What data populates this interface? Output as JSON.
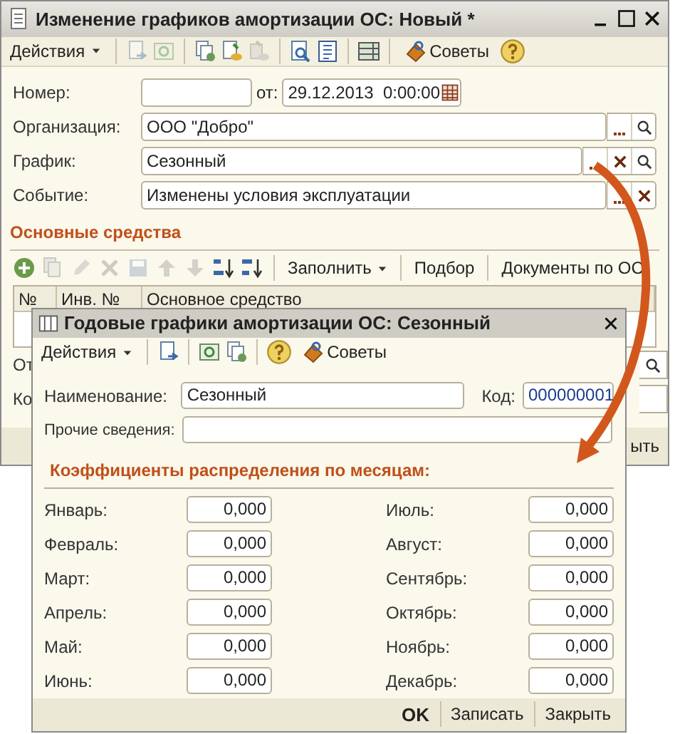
{
  "outer_window": {
    "title": "Изменение графиков амортизации ОС: Новый *",
    "toolbar": {
      "menu": "Действия",
      "icon_buttons": [
        {
          "disabled": true
        },
        {
          "disabled": true
        },
        {
          "disabled": false
        },
        {
          "disabled": false
        },
        {
          "disabled": true
        },
        {
          "disabled": false
        },
        {
          "disabled": false
        },
        {
          "disabled": false
        }
      ],
      "tips": "Советы"
    },
    "number": {
      "label": "Номер:",
      "date_label": "от:",
      "date": "29.12.2013  0:00:00"
    },
    "fields": [
      {
        "label": "Организация:",
        "value": "ООО \"Добро\"",
        "clear": false,
        "search": true
      },
      {
        "label": "График:",
        "value": "Сезонный",
        "clear": true,
        "search": true
      },
      {
        "label": "Событие:",
        "value": "Изменены условия эксплуатации",
        "clear": true,
        "search": false
      }
    ],
    "section": "Основные средства",
    "table_toolbar": {
      "icon_buttons": [
        {
          "disabled": false
        },
        {
          "disabled": true
        },
        {
          "disabled": true
        },
        {
          "disabled": true
        },
        {
          "disabled": true
        },
        {
          "disabled": true
        },
        {
          "disabled": true
        },
        {
          "disabled": false
        },
        {
          "disabled": false
        }
      ],
      "buttons": [
        {
          "kind": "menu",
          "label": "Заполнить"
        },
        {
          "kind": "plain",
          "label": "Подбор"
        },
        {
          "kind": "plain",
          "label": "Документы по ОС"
        }
      ]
    },
    "table": {
      "columns": [
        "№",
        "Инв. №",
        "Основное средство"
      ]
    },
    "hidden_rows": [
      {
        "label": "От",
        "search": true
      },
      {
        "label": "Ко",
        "search": false
      }
    ],
    "footer_button": "ыть"
  },
  "inner_window": {
    "title": "Годовые графики амортизации ОС: Сезонный",
    "toolbar": {
      "menu": "Действия",
      "tips": "Советы"
    },
    "name": {
      "label": "Наименование:",
      "value": "Сезонный"
    },
    "code": {
      "label": "Код:",
      "value": "000000001"
    },
    "other": {
      "label": "Прочие сведения:"
    },
    "section": "Коэффициенты распределения по месяцам:",
    "months": [
      {
        "label": "Январь:",
        "value": "0,000"
      },
      {
        "label": "Февраль:",
        "value": "0,000"
      },
      {
        "label": "Март:",
        "value": "0,000"
      },
      {
        "label": "Апрель:",
        "value": "0,000"
      },
      {
        "label": "Май:",
        "value": "0,000"
      },
      {
        "label": "Июнь:",
        "value": "0,000"
      },
      {
        "label": "Июль:",
        "value": "0,000"
      },
      {
        "label": "Август:",
        "value": "0,000"
      },
      {
        "label": "Сентябрь:",
        "value": "0,000"
      },
      {
        "label": "Октябрь:",
        "value": "0,000"
      },
      {
        "label": "Ноябрь:",
        "value": "0,000"
      },
      {
        "label": "Декабрь:",
        "value": "0,000"
      }
    ],
    "footer_buttons": [
      {
        "label": "OK",
        "default": true
      },
      {
        "label": "Записать",
        "default": false
      },
      {
        "label": "Закрыть",
        "default": false
      }
    ]
  }
}
